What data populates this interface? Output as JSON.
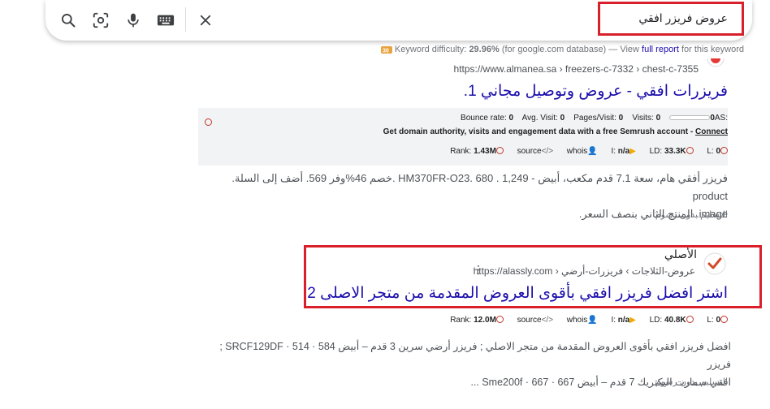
{
  "search": {
    "query": "عروض فريزر افقي",
    "icons": [
      "search-icon",
      "lens-icon",
      "mic-icon",
      "keyboard-icon",
      "close-icon"
    ]
  },
  "keyword_difficulty": {
    "label": "Keyword difficulty:",
    "value": "29.96%",
    "db_note": "(for google.com database) — View",
    "link": "full report",
    "suffix": "for this keyword"
  },
  "result1": {
    "breadcrumb": "https://www.almanea.sa › freezers-c-7332 › chest-c-7355",
    "title": "فريزرات افقي - عروض وتوصيل مجاني 1.",
    "semrush": {
      "as_label": "AS:",
      "as_value": "0",
      "visits_label": "Visits:",
      "visits_value": "0",
      "pages_label": "Pages/Visit:",
      "pages_value": "0",
      "avg_label": "Avg. Visit:",
      "avg_value": "0",
      "bounce_label": "Bounce rate:",
      "bounce_value": "0",
      "promo": "Get domain authority, visits and engagement data with a free Semrush account -",
      "connect": "Connect",
      "rank_label": "Rank:",
      "rank_value": "1.43M",
      "source_label": "source",
      "whois_label": "whois",
      "i_label": "I:",
      "i_value": "n/a",
      "ld_label": "LD:",
      "ld_value": "33.3K",
      "l_label": "L:",
      "l_value": "0"
    },
    "snippet_line1": "فريزر أفقي هام، سعة 7.1 قدم مكعب، أبيض - 1,249 . 680 .HM370FR-O23 .خصم 46%وفر 569. أضف إلى السلة. product",
    "snippet_line2": "image. المنتج الثاني بنصف السعر.",
    "delivery": "التسليم بدون رسوم"
  },
  "result2": {
    "site_name": "الأصلي",
    "breadcrumb": "https://alassly.com › عروض-الثلاجات › فريزرات-أرضي",
    "title": "اشتر افضل فريزر افقي بأقوى العروض المقدمة من متجر الاصلى 2.",
    "metrics": {
      "rank_label": "Rank:",
      "rank_value": "12.0M",
      "source_label": "source",
      "whois_label": "whois",
      "i_label": "I:",
      "i_value": "n/a",
      "ld_label": "LD:",
      "ld_value": "40.8K",
      "l_label": "L:",
      "l_value": "0"
    },
    "snippet_line1": "افضل فريزر افقي بأقوى العروض المقدمة من متجر الاصلي ; فريزر أرضي سرين 3 قدم – أبيض SRCF129DF · 514 · 584 ; فريزر",
    "snippet_line2": "افقي سمارت اليكتريك 7 قدم – أبيض 667 · 667 · Sme200f ...",
    "delivery": "التسليم بدون رسوم"
  },
  "colors": {
    "link": "#1a0dab",
    "annotation_red": "#d9202a",
    "panel_bg": "#f1f3f4"
  }
}
